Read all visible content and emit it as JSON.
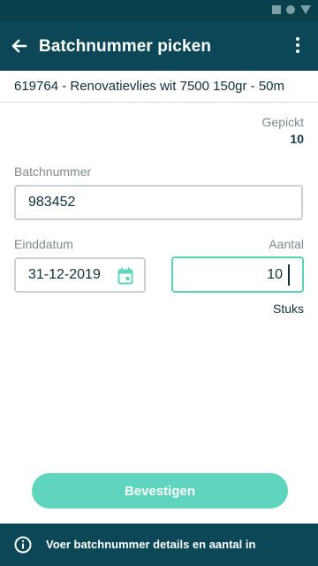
{
  "header": {
    "title": "Batchnummer picken",
    "back_icon": "arrow-left-icon",
    "menu_icon": "more-vert-icon"
  },
  "product": {
    "description": "619764 - Renovatievlies wit 7500 150gr - 50m"
  },
  "picked": {
    "label": "Gepickt",
    "value": "10"
  },
  "form": {
    "batch_label": "Batchnummer",
    "batch_value": "983452",
    "date_label": "Einddatum",
    "date_value": "31-12-2019",
    "quantity_label": "Aantal",
    "quantity_value": "10",
    "unit": "Stuks"
  },
  "actions": {
    "confirm_label": "Bevestigen"
  },
  "footer": {
    "info_text": "Voer batchnummer details en aantal in"
  },
  "colors": {
    "header_bg": "#0b4756",
    "accent": "#5fd5bd",
    "active_border": "#5bd1b6"
  }
}
